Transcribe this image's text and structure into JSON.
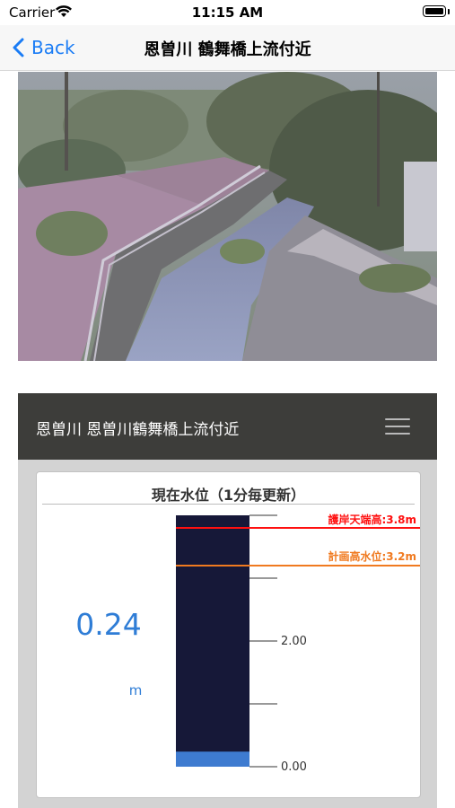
{
  "status_bar": {
    "carrier": "Carrier",
    "time": "11:15 AM"
  },
  "nav": {
    "back_label": "Back",
    "title": "恩曽川 鶴舞橋上流付近"
  },
  "panel": {
    "title": "恩曽川 恩曽川鶴舞橋上流付近",
    "card_title": "現在水位（1分毎更新）",
    "current_level": "0.24",
    "unit": "m"
  },
  "gauge": {
    "max": 4.0,
    "level": 0.24,
    "ticks": [
      "2.00",
      "0.00"
    ],
    "embankment": {
      "label": "護岸天端高:3.8m",
      "value": 3.8,
      "color": "#ff1010"
    },
    "plan_level": {
      "label": "計画高水位:3.2m",
      "value": 3.2,
      "color": "#f07a20"
    },
    "bar_color": "#161838",
    "water_color": "#3e7bd0"
  }
}
